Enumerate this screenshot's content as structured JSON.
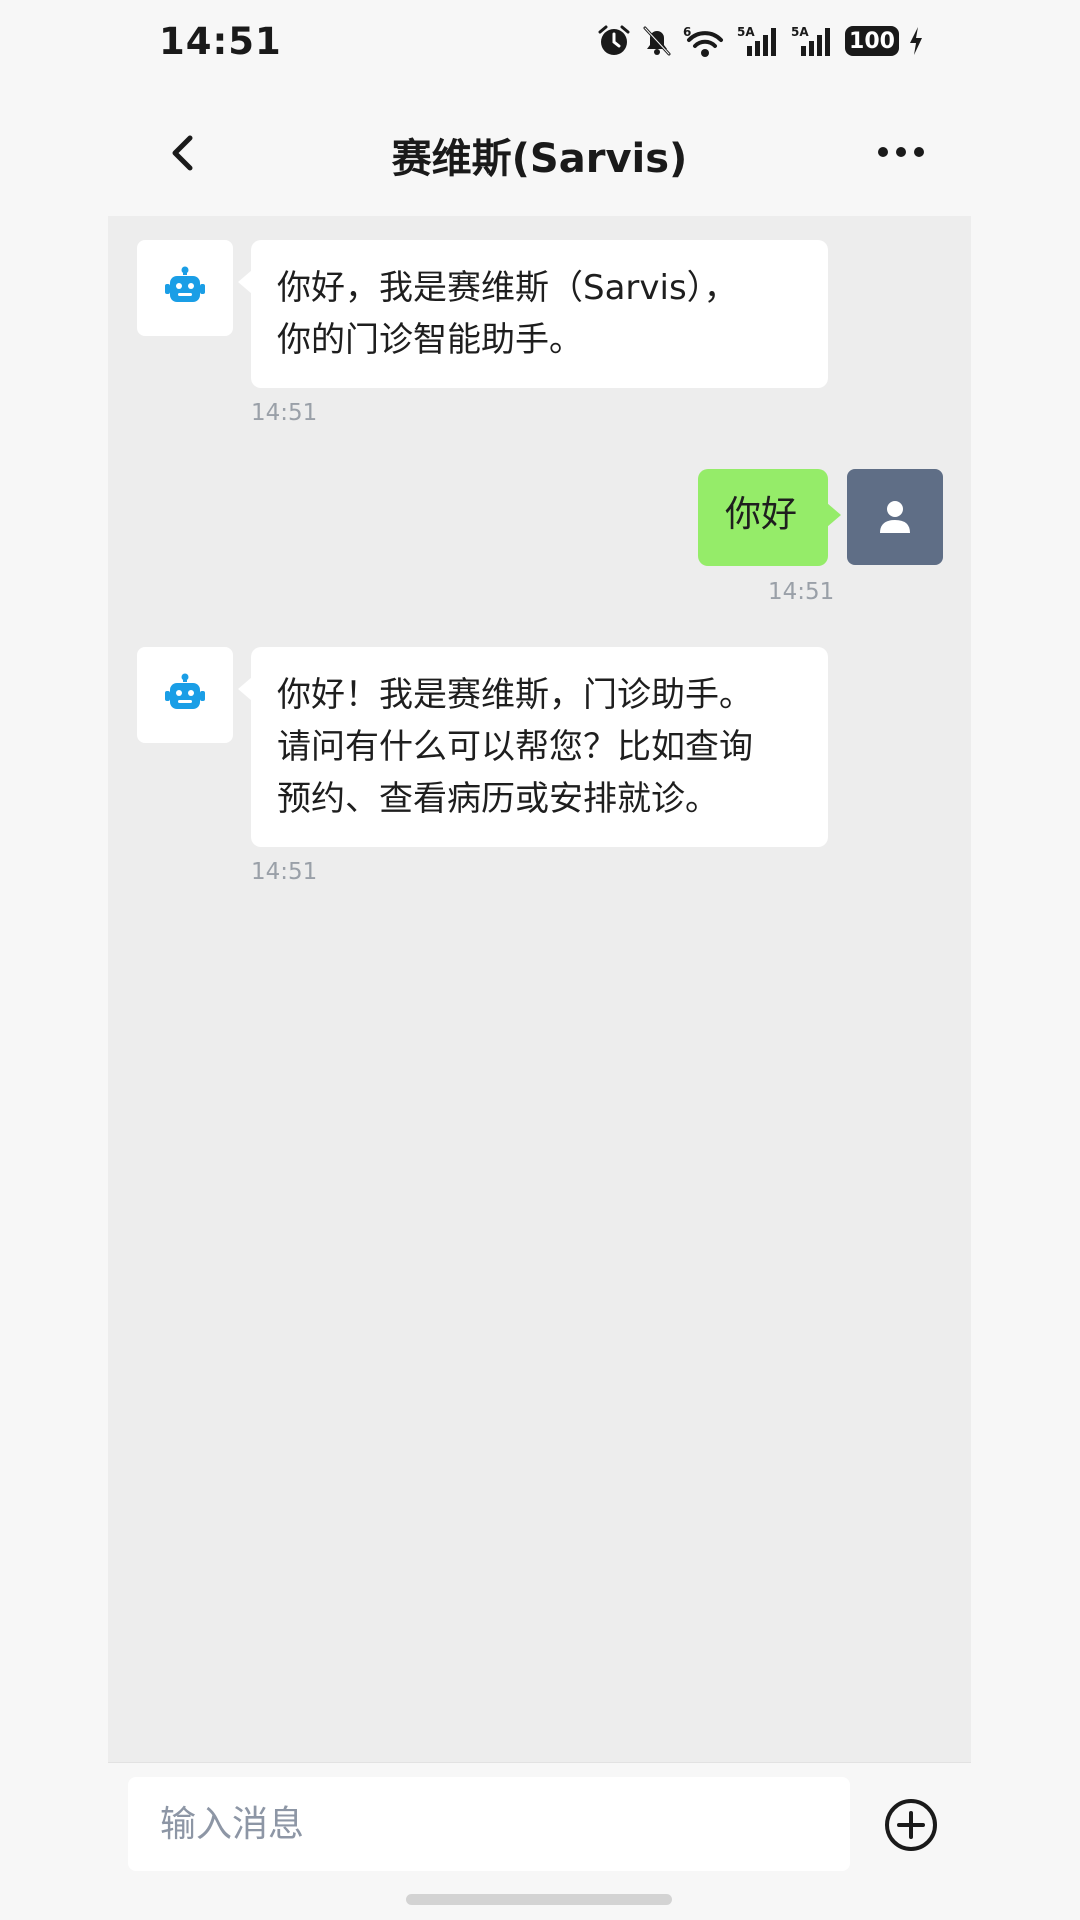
{
  "status_bar": {
    "time": "14:51",
    "battery": "100",
    "icons": [
      "alarm-icon",
      "mute-bell-icon",
      "wifi-6-icon",
      "signal-5a-icon",
      "signal-5a-icon",
      "battery-icon",
      "charging-icon"
    ],
    "network_labels": [
      "6",
      "5A",
      "5A"
    ]
  },
  "nav": {
    "title": "赛维斯(Sarvis)",
    "back_icon": "chevron-left-icon",
    "more_icon": "more-dots-icon"
  },
  "messages": [
    {
      "sender": "bot",
      "avatar_icon": "robot-icon",
      "lines": [
        "你好，我是赛维斯（Sarvis），",
        "你的门诊智能助手。"
      ],
      "time": "14:51"
    },
    {
      "sender": "user",
      "avatar_icon": "user-icon",
      "lines": [
        "你好"
      ],
      "time": "14:51"
    },
    {
      "sender": "bot",
      "avatar_icon": "robot-icon",
      "lines": [
        "你好！我是赛维斯，门诊助手。",
        "请问有什么可以帮您？比如查询",
        "预约、查看病历或安排就诊。"
      ],
      "time": "14:51"
    }
  ],
  "input": {
    "placeholder": "输入消息",
    "value": "",
    "plus_icon": "plus-circle-icon"
  },
  "colors": {
    "bot_icon": "#1a9ee6",
    "user_bubble": "#95ec69",
    "user_avatar": "#5f6e86",
    "chat_background": "#ededed"
  }
}
